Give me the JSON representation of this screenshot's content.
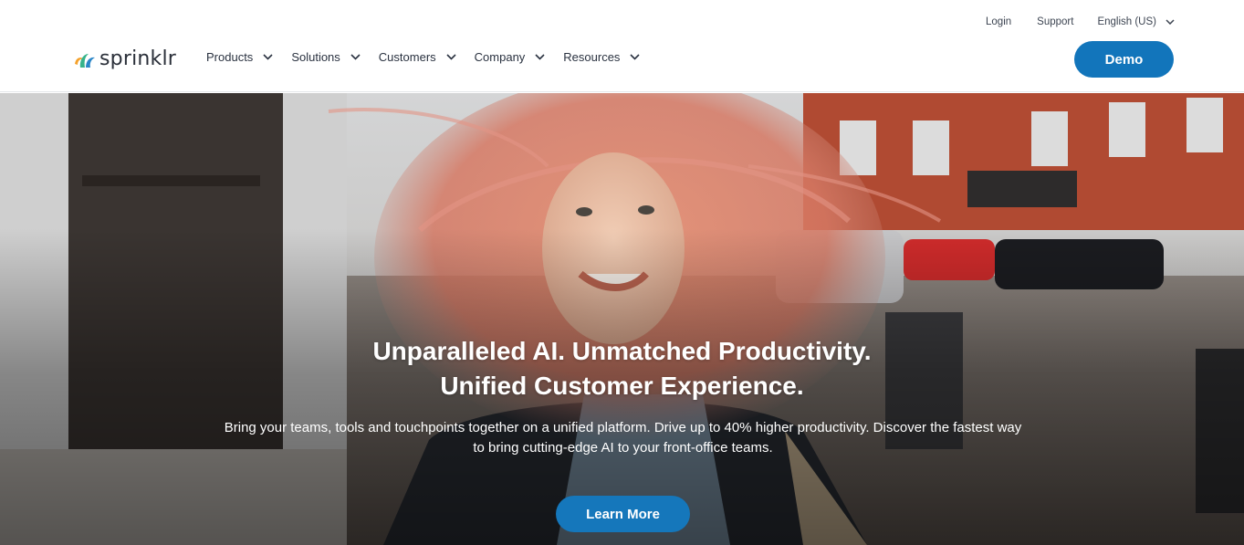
{
  "brand": {
    "name": "sprinklr",
    "logo_icon": "sprinklr-flame-logo",
    "colors": {
      "primary": "#1275bb",
      "orange": "#f4a12a",
      "teal": "#36b38b",
      "blue": "#2a86c8"
    }
  },
  "utility_nav": {
    "login": "Login",
    "support": "Support",
    "language": "English (US)"
  },
  "main_nav": {
    "items": [
      {
        "label": "Products"
      },
      {
        "label": "Solutions"
      },
      {
        "label": "Customers"
      },
      {
        "label": "Company"
      },
      {
        "label": "Resources"
      }
    ]
  },
  "header": {
    "demo_label": "Demo"
  },
  "hero": {
    "headline_line1": "Unparalleled AI. Unmatched Productivity.",
    "headline_line2": "Unified Customer Experience.",
    "subcopy_line1": "Bring your teams, tools and touchpoints together on a unified platform. Drive up to 40% higher productivity. Discover the fastest way",
    "subcopy_line2": "to bring cutting-edge AI to your front-office teams.",
    "cta_label": "Learn More",
    "image": "woman-with-windblown-pink-hair-on-street"
  }
}
